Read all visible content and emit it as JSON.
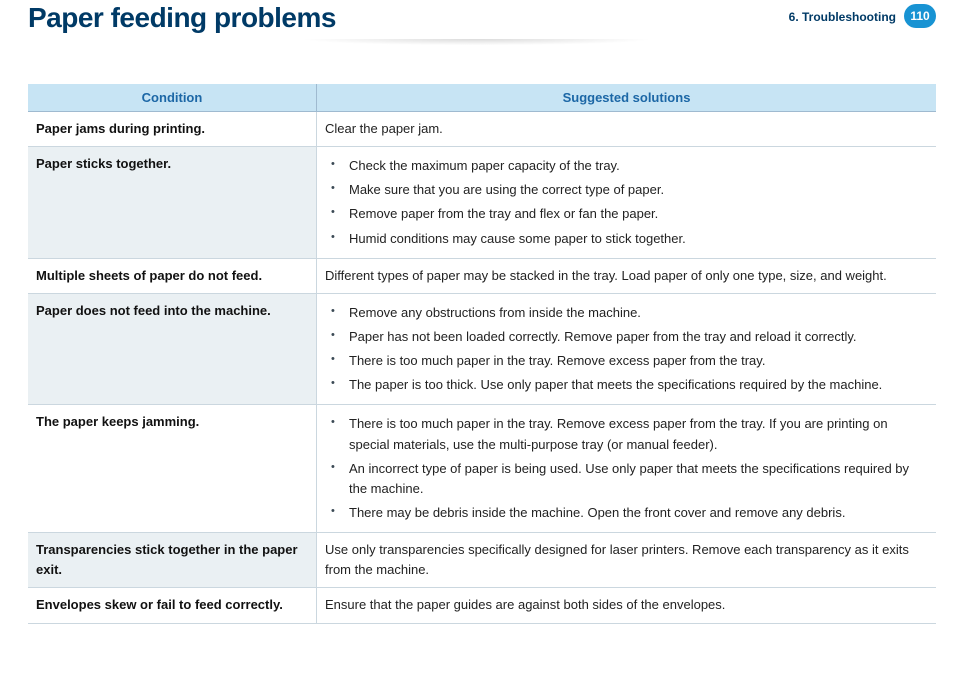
{
  "header": {
    "title": "Paper feeding problems",
    "chapter": "6.  Troubleshooting",
    "page": "110"
  },
  "table": {
    "head": {
      "col1": "Condition",
      "col2": "Suggested solutions"
    },
    "rows": [
      {
        "shade": false,
        "condition": "Paper jams during printing.",
        "type": "text",
        "text": "Clear the paper jam."
      },
      {
        "shade": true,
        "condition": "Paper sticks together.",
        "type": "list",
        "items": [
          "Check the maximum paper capacity of the tray.",
          "Make sure that you are using the correct type of paper.",
          "Remove paper from the tray and flex or fan the paper.",
          "Humid conditions may cause some paper to stick together."
        ]
      },
      {
        "shade": false,
        "condition": "Multiple sheets of paper do not feed.",
        "type": "text",
        "text": "Different types of paper may be stacked in the tray. Load paper of only one type, size, and weight."
      },
      {
        "shade": true,
        "condition": "Paper does not feed into the machine.",
        "type": "list",
        "items": [
          "Remove any obstructions from inside the machine.",
          "Paper has not been loaded correctly. Remove paper from the tray and reload it correctly.",
          "There is too much paper in the tray. Remove excess paper from the tray.",
          "The paper is too thick. Use only paper that meets the specifications required by the machine."
        ]
      },
      {
        "shade": false,
        "condition": "The paper keeps jamming.",
        "type": "list",
        "items": [
          "There is too much paper in the tray. Remove excess paper from the tray. If you are printing on special materials, use the multi-purpose tray (or manual feeder).",
          "An incorrect type of paper is being used. Use only paper that meets the specifications required by the machine.",
          "There may be debris inside the machine. Open the front cover and remove any debris."
        ]
      },
      {
        "shade": true,
        "condition": "Transparencies stick together in the paper exit.",
        "type": "text",
        "text": "Use only transparencies specifically designed for laser printers. Remove each transparency as it exits from the machine."
      },
      {
        "shade": false,
        "condition": "Envelopes skew or fail to feed correctly.",
        "type": "text",
        "text": "Ensure that the paper guides are against both sides of the envelopes."
      }
    ]
  }
}
